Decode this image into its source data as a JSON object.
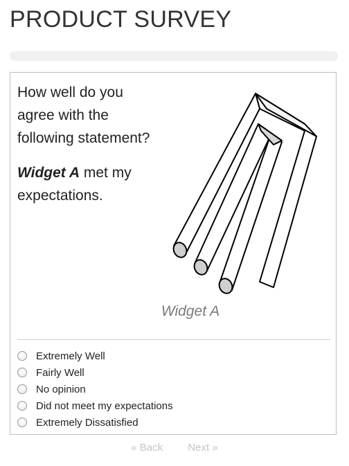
{
  "survey": {
    "title": "PRODUCT SURVEY",
    "progress": 0
  },
  "question": {
    "lines": [
      "How well do you",
      "agree with the",
      "following statement?"
    ],
    "product_name": "Widget A",
    "statement_rest": " met my expectations.",
    "image_caption": "Widget A",
    "image_icon": "impossible-trident-icon"
  },
  "options": [
    {
      "label": "Extremely Well",
      "selected": false
    },
    {
      "label": "Fairly Well",
      "selected": false
    },
    {
      "label": "No opinion",
      "selected": false
    },
    {
      "label": "Did not meet my expectations",
      "selected": false
    },
    {
      "label": "Extremely Dissatisfied",
      "selected": false
    }
  ],
  "nav": {
    "back_label": "« Back",
    "next_label": "Next »"
  }
}
